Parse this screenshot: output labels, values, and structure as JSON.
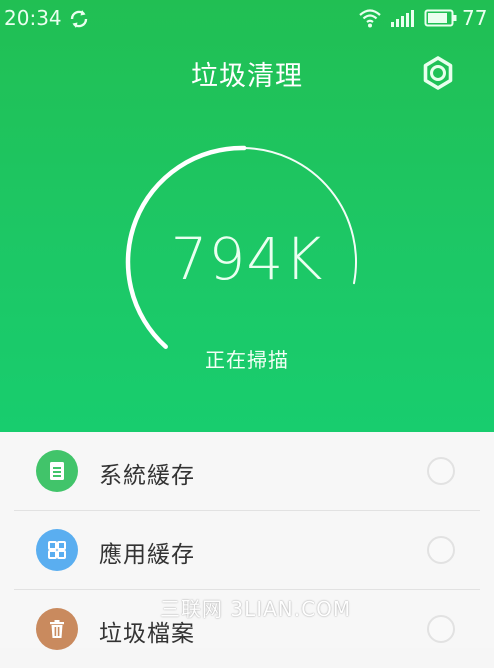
{
  "status_bar": {
    "time": "20:34",
    "battery_level": "77",
    "icons": [
      "sync-icon",
      "wifi-icon",
      "signal-icon",
      "battery-icon"
    ]
  },
  "header": {
    "title": "垃圾清理",
    "settings_icon": "gear-icon"
  },
  "scan": {
    "size": "794K",
    "status_text": "正在掃描",
    "progress": 0.72
  },
  "categories": [
    {
      "label": "系統緩存",
      "icon": "document-icon",
      "color": "#41c46a"
    },
    {
      "label": "應用緩存",
      "icon": "apps-grid-icon",
      "color": "#5aaef0"
    },
    {
      "label": "垃圾檔案",
      "icon": "trash-icon",
      "color": "#c98a5e"
    }
  ],
  "watermark": "三联网 3LIAN.COM",
  "colors": {
    "accent": "#1fc45c",
    "list_background": "#f7f7f7"
  }
}
